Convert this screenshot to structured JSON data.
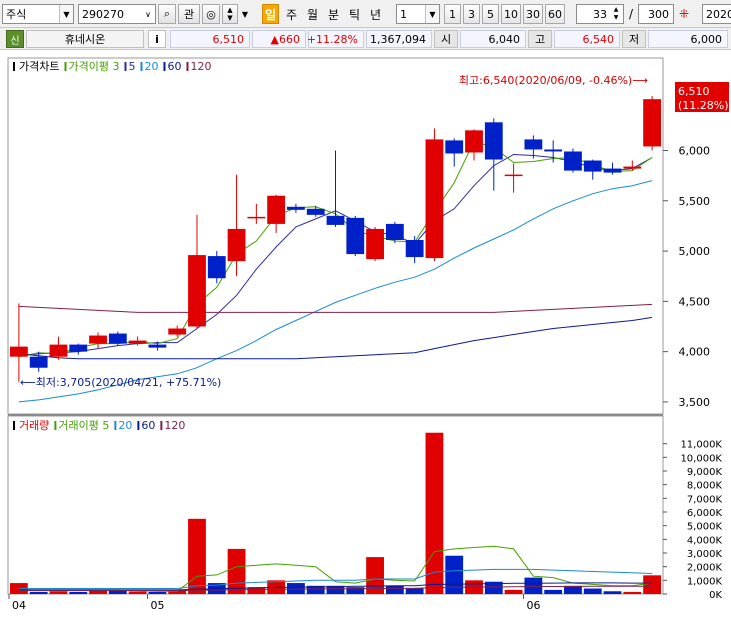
{
  "toolbar": {
    "market_select": "주식",
    "code_input": "290270",
    "btn_search": "⌕",
    "btn_gwan": "관",
    "btn_star": "◎",
    "periods": [
      {
        "label": "일",
        "active": true
      },
      {
        "label": "주",
        "active": false
      },
      {
        "label": "월",
        "active": false
      },
      {
        "label": "분",
        "active": false
      },
      {
        "label": "틱",
        "active": false
      },
      {
        "label": "년",
        "active": false
      }
    ],
    "interval_select": "1",
    "interval_buttons": [
      "1",
      "3",
      "5",
      "10",
      "30",
      "60"
    ],
    "view_count": "33",
    "slash": "/",
    "total_count": "300",
    "date_input": "2020/"
  },
  "quote": {
    "badge": "신",
    "name": "휴네시온",
    "info_btn": "i",
    "price": "6,510",
    "change": "▲660",
    "change_rate": "+11.28%",
    "volume": "1,367,094",
    "open_label": "시",
    "open": "6,040",
    "high_label": "고",
    "high": "6,540",
    "low_label": "저",
    "low": "6,000"
  },
  "colors": {
    "up": "#e00000",
    "down": "#0020c8",
    "ma3": "#44a000",
    "ma5": "#2a2aa8",
    "ma20": "#1a8ad0",
    "ma60": "#0a1a90",
    "ma120": "#80204a"
  },
  "price_panel": {
    "legend": [
      {
        "text": "가격차트",
        "color": "#000000"
      },
      {
        "text": "가격이평 3",
        "color": "#44a000"
      },
      {
        "text": "5",
        "color": "#2a2aa8"
      },
      {
        "text": "20",
        "color": "#1a8ad0"
      },
      {
        "text": "60",
        "color": "#0a1a90"
      },
      {
        "text": "120",
        "color": "#80204a"
      }
    ],
    "high_annotation": "최고:6,540(2020/06/09, -0.46%)⟶",
    "low_annotation": "⟵최저:3,705(2020/04/21, +75.71%)",
    "last_price_label": "6,510",
    "last_rate_label": "(11.28%)",
    "y_ticks": [
      "6,000",
      "5,500",
      "5,000",
      "4,500",
      "4,000",
      "3,500"
    ]
  },
  "volume_panel": {
    "legend": [
      {
        "text": "거래량",
        "color": "#e00000"
      },
      {
        "text": "거래이평 5",
        "color": "#44a000"
      },
      {
        "text": "20",
        "color": "#1a8ad0"
      },
      {
        "text": "60",
        "color": "#0a1a90"
      },
      {
        "text": "120",
        "color": "#80204a"
      }
    ],
    "y_ticks": [
      "11,000K",
      "10,000K",
      "9,000K",
      "8,000K",
      "7,000K",
      "6,000K",
      "5,000K",
      "4,000K",
      "3,000K",
      "2,000K",
      "1,000K",
      "0K"
    ]
  },
  "x_ticks": [
    {
      "label": "04",
      "index": 0
    },
    {
      "label": "05",
      "index": 7
    },
    {
      "label": "06",
      "index": 26
    }
  ],
  "chart_data": {
    "type": "candlestick",
    "ylim": [
      3400,
      6800
    ],
    "volume_ylim": [
      0,
      12000
    ],
    "candles": [
      {
        "o": 3950,
        "c": 4050,
        "h": 4480,
        "l": 3700,
        "v": 800
      },
      {
        "o": 3950,
        "c": 3840,
        "h": 4000,
        "l": 3800,
        "v": 150
      },
      {
        "o": 3950,
        "c": 4070,
        "h": 4150,
        "l": 3920,
        "v": 200
      },
      {
        "o": 4070,
        "c": 4000,
        "h": 4080,
        "l": 3970,
        "v": 150
      },
      {
        "o": 4080,
        "c": 4160,
        "h": 4190,
        "l": 4030,
        "v": 300
      },
      {
        "o": 4180,
        "c": 4080,
        "h": 4200,
        "l": 4060,
        "v": 250
      },
      {
        "o": 4080,
        "c": 4110,
        "h": 4150,
        "l": 4060,
        "v": 180
      },
      {
        "o": 4070,
        "c": 4040,
        "h": 4100,
        "l": 4010,
        "v": 150
      },
      {
        "o": 4170,
        "c": 4230,
        "h": 4260,
        "l": 4150,
        "v": 300
      },
      {
        "o": 4250,
        "c": 4960,
        "h": 5360,
        "l": 4230,
        "v": 5500
      },
      {
        "o": 4950,
        "c": 4730,
        "h": 5000,
        "l": 4680,
        "v": 800
      },
      {
        "o": 4900,
        "c": 5220,
        "h": 5760,
        "l": 4750,
        "v": 3300
      },
      {
        "o": 5330,
        "c": 5340,
        "h": 5470,
        "l": 5270,
        "v": 500
      },
      {
        "o": 5270,
        "c": 5550,
        "h": 5560,
        "l": 5180,
        "v": 1000
      },
      {
        "o": 5440,
        "c": 5410,
        "h": 5470,
        "l": 5380,
        "v": 800
      },
      {
        "o": 5420,
        "c": 5360,
        "h": 5450,
        "l": 5340,
        "v": 600
      },
      {
        "o": 5350,
        "c": 5260,
        "h": 6000,
        "l": 5240,
        "v": 600
      },
      {
        "o": 5330,
        "c": 4970,
        "h": 5350,
        "l": 4950,
        "v": 500
      },
      {
        "o": 4920,
        "c": 5220,
        "h": 5240,
        "l": 4900,
        "v": 2700
      },
      {
        "o": 5270,
        "c": 5110,
        "h": 5290,
        "l": 5080,
        "v": 600
      },
      {
        "o": 5110,
        "c": 4940,
        "h": 5150,
        "l": 4880,
        "v": 400
      },
      {
        "o": 4930,
        "c": 6110,
        "h": 6220,
        "l": 4900,
        "v": 11800
      },
      {
        "o": 6100,
        "c": 5970,
        "h": 6120,
        "l": 5840,
        "v": 2800
      },
      {
        "o": 5980,
        "c": 6200,
        "h": 6210,
        "l": 5900,
        "v": 1000
      },
      {
        "o": 6280,
        "c": 5910,
        "h": 6320,
        "l": 5600,
        "v": 900
      },
      {
        "o": 5760,
        "c": 5760,
        "h": 5870,
        "l": 5580,
        "v": 300
      },
      {
        "o": 6110,
        "c": 6010,
        "h": 6150,
        "l": 5920,
        "v": 1200
      },
      {
        "o": 6010,
        "c": 5990,
        "h": 6100,
        "l": 5880,
        "v": 300
      },
      {
        "o": 5990,
        "c": 5800,
        "h": 6020,
        "l": 5780,
        "v": 600
      },
      {
        "o": 5900,
        "c": 5790,
        "h": 5910,
        "l": 5710,
        "v": 400
      },
      {
        "o": 5820,
        "c": 5780,
        "h": 5880,
        "l": 5760,
        "v": 200
      },
      {
        "o": 5820,
        "c": 5840,
        "h": 5900,
        "l": 5800,
        "v": 150
      },
      {
        "o": 6040,
        "c": 6510,
        "h": 6540,
        "l": 6000,
        "v": 1367
      }
    ],
    "series": [
      {
        "name": "5",
        "values": [
          3960,
          3980,
          3990,
          4000,
          4030,
          4060,
          4080,
          4090,
          4090,
          4230,
          4370,
          4560,
          4820,
          5040,
          5240,
          5320,
          5400,
          5300,
          5190,
          5160,
          5070,
          5300,
          5420,
          5650,
          5850,
          5960,
          5950,
          5930,
          5890,
          5830,
          5800,
          5820,
          5930
        ]
      },
      {
        "name": "3",
        "values": [
          3950,
          3990,
          3980,
          4040,
          4080,
          4080,
          4100,
          4080,
          4130,
          4470,
          4640,
          4970,
          5100,
          5350,
          5430,
          5440,
          5370,
          5200,
          5150,
          5100,
          5090,
          5390,
          5680,
          6090,
          6030,
          5880,
          5890,
          5920,
          5930,
          5860,
          5790,
          5800,
          5930
        ]
      },
      {
        "name": "20",
        "values": [
          3500,
          3520,
          3550,
          3580,
          3620,
          3670,
          3720,
          3750,
          3780,
          3840,
          3930,
          4010,
          4110,
          4220,
          4310,
          4400,
          4490,
          4560,
          4630,
          4690,
          4740,
          4820,
          4930,
          5030,
          5120,
          5210,
          5320,
          5420,
          5500,
          5570,
          5620,
          5650,
          5700
        ]
      },
      {
        "name": "60",
        "values": [
          3980,
          3960,
          3940,
          3930,
          3930,
          3930,
          3930,
          3930,
          3930,
          3930,
          3930,
          3930,
          3930,
          3930,
          3930,
          3940,
          3950,
          3960,
          3970,
          3980,
          3990,
          4030,
          4070,
          4110,
          4140,
          4170,
          4200,
          4230,
          4250,
          4270,
          4290,
          4310,
          4340
        ]
      },
      {
        "name": "120",
        "values": [
          4450,
          4440,
          4430,
          4420,
          4410,
          4400,
          4390,
          4390,
          4390,
          4390,
          4390,
          4390,
          4390,
          4390,
          4390,
          4390,
          4390,
          4390,
          4390,
          4390,
          4390,
          4390,
          4390,
          4390,
          4390,
          4400,
          4410,
          4420,
          4430,
          4440,
          4450,
          4460,
          4470
        ]
      }
    ],
    "volume_series": [
      {
        "name": "5",
        "values": [
          300,
          300,
          300,
          300,
          300,
          300,
          250,
          200,
          200,
          1300,
          1400,
          2000,
          2100,
          2200,
          2100,
          2000,
          900,
          800,
          1100,
          1000,
          950,
          3100,
          3300,
          3400,
          3500,
          3300,
          1300,
          1200,
          800,
          700,
          600,
          600,
          800
        ]
      },
      {
        "name": "20",
        "values": [
          400,
          400,
          400,
          400,
          400,
          400,
          400,
          400,
          400,
          600,
          650,
          800,
          850,
          900,
          950,
          1000,
          1000,
          1000,
          1100,
          1100,
          1100,
          1600,
          1700,
          1750,
          1800,
          1800,
          1800,
          1750,
          1700,
          1650,
          1600,
          1550,
          1500
        ]
      },
      {
        "name": "60",
        "values": [
          300,
          300,
          300,
          300,
          300,
          300,
          300,
          300,
          300,
          350,
          380,
          420,
          450,
          480,
          500,
          520,
          540,
          560,
          580,
          600,
          610,
          700,
          720,
          740,
          760,
          780,
          790,
          800,
          810,
          810,
          810,
          800,
          800
        ]
      },
      {
        "name": "120",
        "values": [
          250,
          250,
          250,
          250,
          250,
          250,
          250,
          250,
          250,
          270,
          290,
          310,
          330,
          350,
          360,
          370,
          380,
          390,
          400,
          410,
          420,
          470,
          490,
          510,
          520,
          530,
          540,
          550,
          550,
          560,
          560,
          560,
          560
        ]
      }
    ]
  }
}
